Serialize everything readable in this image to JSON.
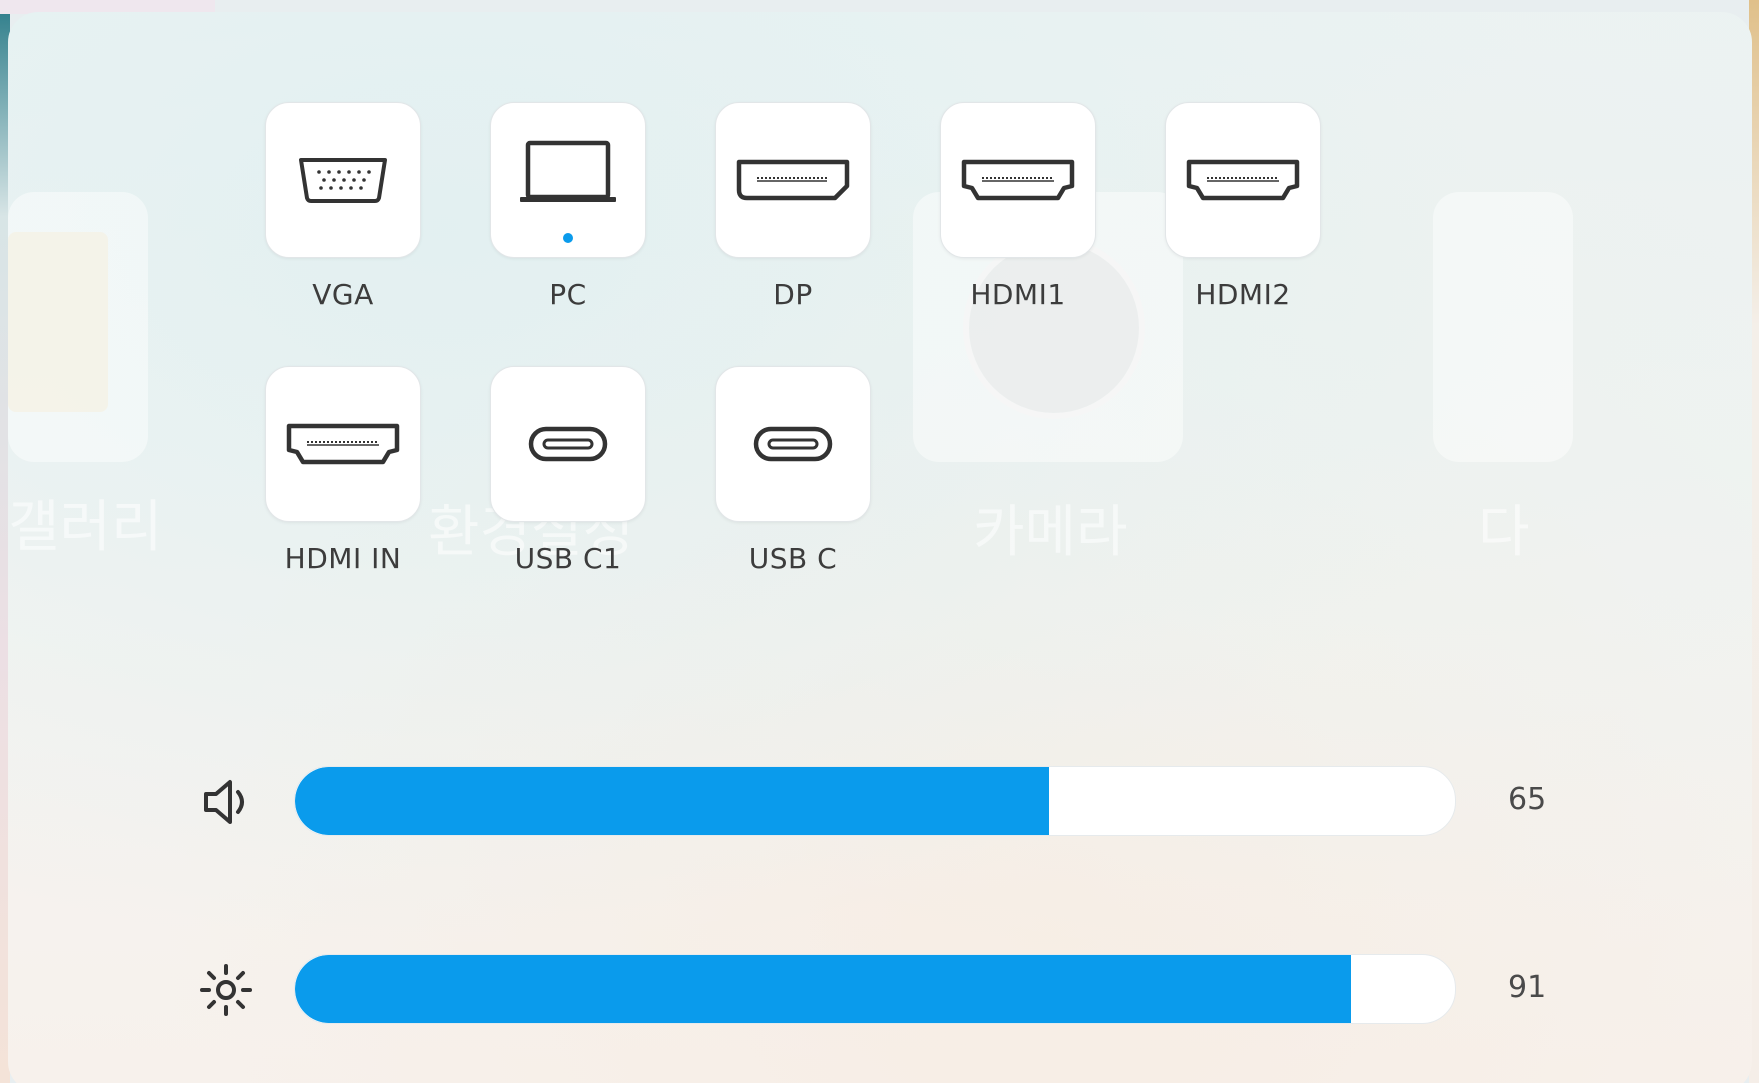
{
  "theme": {
    "accent": "#0a9bec",
    "icon_color": "#333333"
  },
  "background": {
    "ghost_labels": [
      "갤러리",
      "환경설정",
      "카메라",
      "다"
    ]
  },
  "sources": [
    {
      "id": "vga",
      "label": "VGA",
      "icon": "vga-port-icon",
      "active": false
    },
    {
      "id": "pc",
      "label": "PC",
      "icon": "laptop-icon",
      "active": true
    },
    {
      "id": "dp",
      "label": "DP",
      "icon": "displayport-icon",
      "active": false
    },
    {
      "id": "hdmi1",
      "label": "HDMI1",
      "icon": "hdmi-port-icon",
      "active": false
    },
    {
      "id": "hdmi2",
      "label": "HDMI2",
      "icon": "hdmi-port-icon",
      "active": false
    },
    {
      "id": "hdmi-in",
      "label": "HDMI IN",
      "icon": "hdmi-port-icon",
      "active": false
    },
    {
      "id": "usb-c1",
      "label": "USB C1",
      "icon": "usb-c-port-icon",
      "active": false
    },
    {
      "id": "usb-c",
      "label": "USB C",
      "icon": "usb-c-port-icon",
      "active": false
    }
  ],
  "volume": {
    "icon": "speaker-icon",
    "value": "65",
    "level": 65,
    "max": 100
  },
  "brightness": {
    "icon": "brightness-sun-icon",
    "value": "91",
    "level": 91,
    "max": 100
  }
}
